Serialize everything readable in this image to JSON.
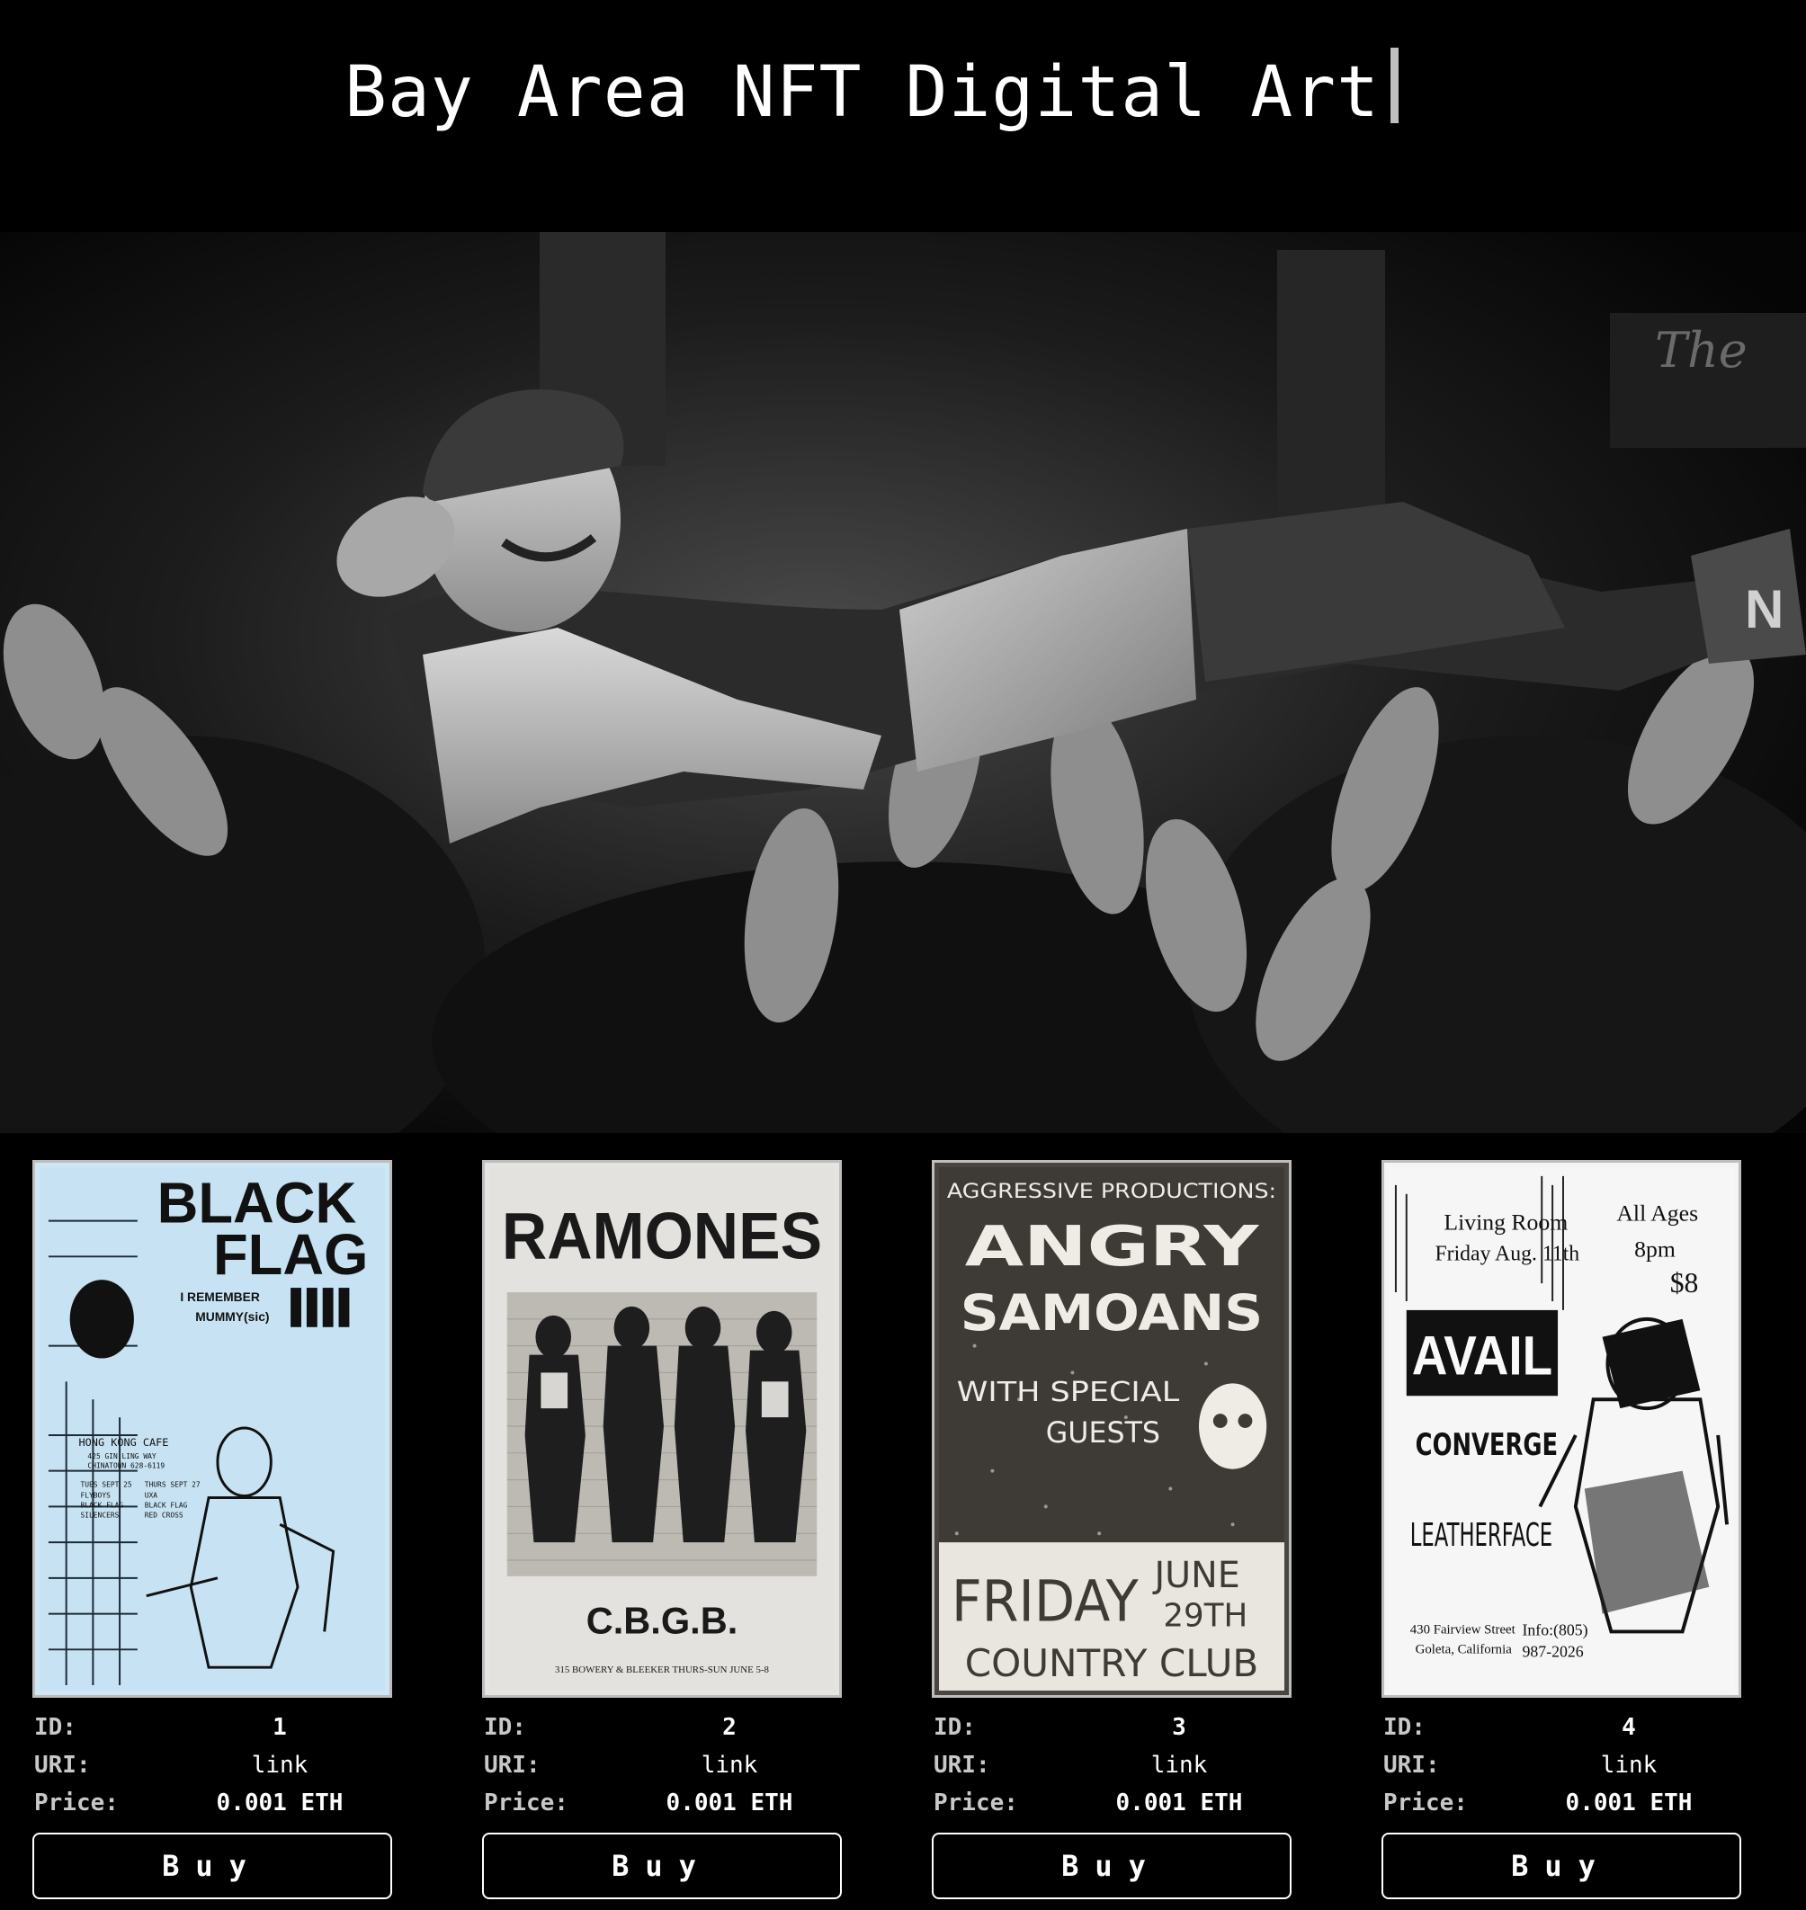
{
  "header": {
    "title": "Bay Area NFT Digital Art"
  },
  "hero": {
    "sign_text": "The"
  },
  "cards": [
    {
      "id_label": "ID:",
      "id": "1",
      "uri_label": "URI:",
      "uri": "link",
      "price_label": "Price:",
      "price": "0.001 ETH",
      "buy_label": "Buy",
      "poster": {
        "line1": "BLACK",
        "line2": "FLAG",
        "line3": "I REMEMBER",
        "line4": "MUMMY(sic)",
        "venue": "HONG KONG CAFE",
        "venue_addr": "425 GIN LING WAY",
        "venue_city": "CHINATOWN 628-6119",
        "lineup_a": "TUES SEPT 25",
        "lineup_b": "FLYBOYS",
        "lineup_c": "BLACK FLAG",
        "lineup_d": "SILENCERS",
        "lineup_e": "THURS SEPT 27",
        "lineup_f": "UXA",
        "lineup_g": "BLACK FLAG",
        "lineup_h": "RED CROSS"
      }
    },
    {
      "id_label": "ID:",
      "id": "2",
      "uri_label": "URI:",
      "uri": "link",
      "price_label": "Price:",
      "price": "0.001 ETH",
      "buy_label": "Buy",
      "poster": {
        "headline": "RAMONES",
        "venue": "C.B.G.B.",
        "footer": "315 BOWERY & BLEEKER  THURS-SUN  JUNE 5-8"
      }
    },
    {
      "id_label": "ID:",
      "id": "3",
      "uri_label": "URI:",
      "uri": "link",
      "price_label": "Price:",
      "price": "0.001 ETH",
      "buy_label": "Buy",
      "poster": {
        "top": "AGGRESSIVE PRODUCTIONS:",
        "band1": "ANGRY",
        "band2": "SAMOANS",
        "with1": "WITH SPECIAL",
        "with2": "GUESTS",
        "day": "FRIDAY",
        "date1": "JUNE",
        "date2": "29TH",
        "venue": "COUNTRY CLUB"
      }
    },
    {
      "id_label": "ID:",
      "id": "4",
      "uri_label": "URI:",
      "uri": "link",
      "price_label": "Price:",
      "price": "0.001 ETH",
      "buy_label": "Buy",
      "poster": {
        "room1": "Living Room",
        "room2": "Friday Aug. 11th",
        "ages1": "All Ages",
        "ages2": "8pm",
        "cost": "$8",
        "band1": "AVAIL",
        "band2": "CONVERGE",
        "band3": "LEATHERFACE",
        "addr1": "430 Fairview Street",
        "addr2": "Goleta, California",
        "info1": "Info:(805)",
        "info2": "987-2026"
      }
    }
  ]
}
